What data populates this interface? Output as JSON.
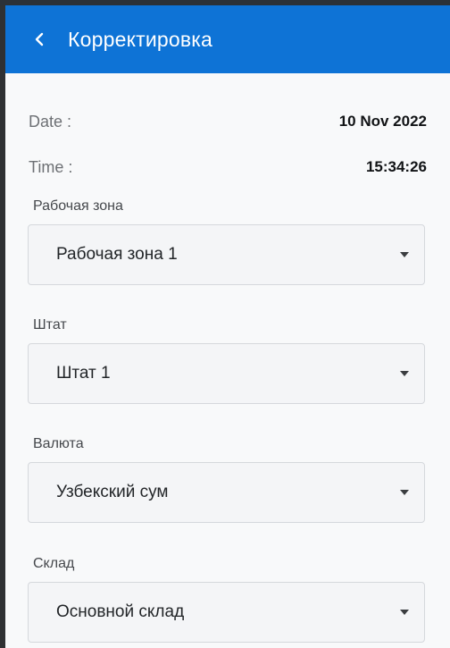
{
  "header": {
    "title": "Корректировка",
    "back_icon": "chevron-left-icon",
    "background": "#0e73d6"
  },
  "info": {
    "date_label": "Date :",
    "date_value": "10 Nov 2022",
    "time_label": "Time :",
    "time_value": "15:34:26"
  },
  "fields": [
    {
      "label": "Рабочая зона",
      "value": "Рабочая зона 1"
    },
    {
      "label": "Штат",
      "value": "Штат 1"
    },
    {
      "label": "Валюта",
      "value": "Узбекский сум"
    },
    {
      "label": "Склад",
      "value": "Основной склад"
    }
  ],
  "icons": {
    "dropdown": "caret-down-icon"
  }
}
